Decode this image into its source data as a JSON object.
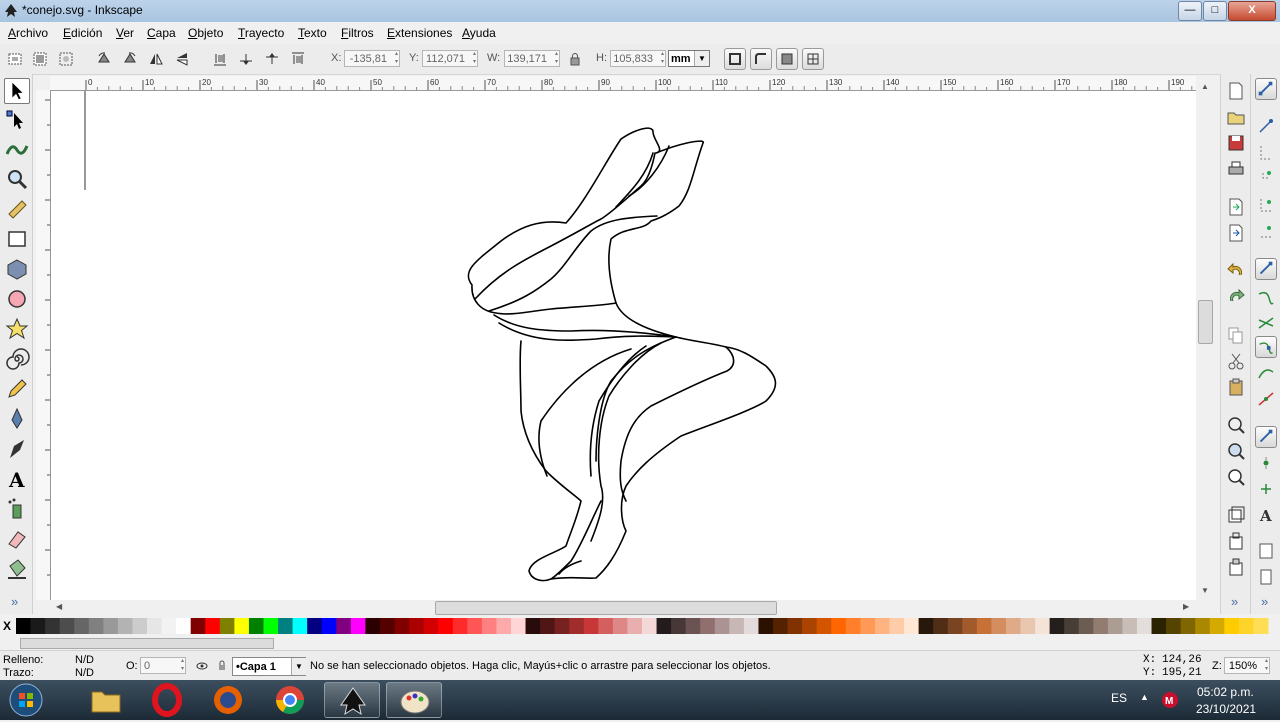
{
  "window": {
    "title": "*conejo.svg - Inkscape",
    "minimize": "—",
    "maximize": "□",
    "close": "X"
  },
  "menu": [
    "Archivo",
    "Edición",
    "Ver",
    "Capa",
    "Objeto",
    "Trayecto",
    "Texto",
    "Filtros",
    "Extensiones",
    "Ayuda"
  ],
  "controls": {
    "x_label": "X:",
    "x_value": "-135,81",
    "y_label": "Y:",
    "y_value": "112,071",
    "w_label": "W:",
    "w_value": "139,171",
    "h_label": "H:",
    "h_value": "105,833",
    "unit": "mm"
  },
  "tools": [
    "selector-tool",
    "node-tool",
    "tweak-tool",
    "zoom-tool",
    "measure-tool",
    "rectangle-tool",
    "3d-box-tool",
    "ellipse-tool",
    "star-tool",
    "spiral-tool",
    "pencil-tool",
    "pen-tool",
    "calligraphy-tool",
    "text-tool",
    "spray-tool",
    "eraser-tool",
    "bucket-tool"
  ],
  "toolbox_more": "»",
  "ruler": {
    "top_labels": [
      "0",
      "10",
      "20",
      "30",
      "40",
      "50",
      "60",
      "70",
      "80",
      "90",
      "100",
      "110",
      "120",
      "130",
      "140",
      "150",
      "160",
      "170",
      "180",
      "190",
      "200"
    ]
  },
  "palette": {
    "none_label": "X",
    "colors": [
      "#000000",
      "#1a1a1a",
      "#333333",
      "#4d4d4d",
      "#666666",
      "#808080",
      "#999999",
      "#b3b3b3",
      "#cccccc",
      "#e6e6e6",
      "#f2f2f2",
      "#ffffff",
      "#800000",
      "#ff0000",
      "#808000",
      "#ffff00",
      "#008000",
      "#00ff00",
      "#008080",
      "#00ffff",
      "#000080",
      "#0000ff",
      "#800080",
      "#ff00ff",
      "#2b0000",
      "#550000",
      "#800000",
      "#aa0000",
      "#d40000",
      "#ff0000",
      "#ff2a2a",
      "#ff5555",
      "#ff8080",
      "#ffaaaa",
      "#ffd5d5",
      "#280b0b",
      "#501616",
      "#782121",
      "#a02c2c",
      "#c83737",
      "#d35f5f",
      "#de8787",
      "#e9afaf",
      "#f4d7d7",
      "#241c1c",
      "#483737",
      "#6c5353",
      "#916f6f",
      "#ac9393",
      "#c8b7b7",
      "#e3dbdb",
      "#2b1100",
      "#552200",
      "#803300",
      "#aa4400",
      "#d45500",
      "#ff6600",
      "#ff7f2a",
      "#ff9955",
      "#ffb380",
      "#ffccaa",
      "#ffe6d5",
      "#28170b",
      "#502d16",
      "#784421",
      "#a05a2c",
      "#c87137",
      "#d38d5f",
      "#deaa87",
      "#e9c6af",
      "#f4e3d7",
      "#241f1c",
      "#483e37",
      "#6c5d53",
      "#917c6f",
      "#ac9d93",
      "#c8beb7",
      "#e3dedb",
      "#2b2200",
      "#554400",
      "#806600",
      "#aa8800",
      "#d4aa00",
      "#ffcc00",
      "#ffd42a",
      "#ffdd55"
    ]
  },
  "status": {
    "fill_label": "Relleno:",
    "fill_value": "N/D",
    "stroke_label": "Trazo:",
    "stroke_value": "N/D",
    "opacity_label": "O:",
    "opacity_value": "0",
    "layer": "•Capa 1",
    "message": "No se han seleccionado objetos. Haga clic, Mayús+clic o arrastre para seleccionar los objetos.",
    "cursor_x_label": "X:",
    "cursor_x": "124,26",
    "cursor_y_label": "Y:",
    "cursor_y": "195,21",
    "zoom_label": "Z:",
    "zoom": "150%"
  },
  "taskbar": {
    "apps": [
      "start-orb",
      "file-explorer",
      "opera",
      "firefox",
      "chrome",
      "inkscape",
      "paint"
    ],
    "language": "ES",
    "time": "05:02 p.m.",
    "date": "23/10/2021"
  },
  "colors": {
    "accent": "#2b5797",
    "canvas": "#ffffff",
    "stroke": "#000000"
  }
}
